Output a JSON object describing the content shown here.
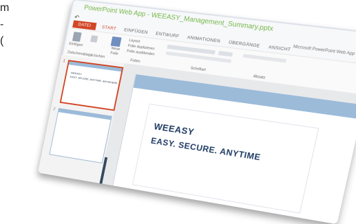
{
  "app": {
    "title": "PowerPoint Web App - WEEASY_Management_Summary.pptx",
    "account": "Microsoft PowerPoint Web App"
  },
  "tabs": [
    {
      "label": "DATEI"
    },
    {
      "label": "START"
    },
    {
      "label": "EINFÜGEN"
    },
    {
      "label": "ENTWURF"
    },
    {
      "label": "ANIMATIONEN"
    },
    {
      "label": "ÜBERGÄNGE"
    },
    {
      "label": "ANSICHT"
    }
  ],
  "ribbon": {
    "paste": "Einfügen",
    "layout": "Layout",
    "new_slide_l1": "Neue",
    "new_slide_l2": "Folie",
    "duplicate": "Folie duplizieren",
    "hide": "Folie ausblenden",
    "group_clipboard": "Zwischenablage",
    "group_delete": "Löschen",
    "group_slides": "Folien",
    "group_font": "Schriftart",
    "group_para": "Absatz"
  },
  "thumbnails": [
    {
      "num": "1",
      "line1": "WEEASY",
      "line2": "EASY. SECURE. ANYTIME. ANYWHERE."
    },
    {
      "num": "2"
    }
  ],
  "slide": {
    "title": "WEEASY",
    "subtitle": "EASY. SECURE. ANYTIME"
  },
  "page_edge_text": [
    "m",
    "-",
    "("
  ]
}
